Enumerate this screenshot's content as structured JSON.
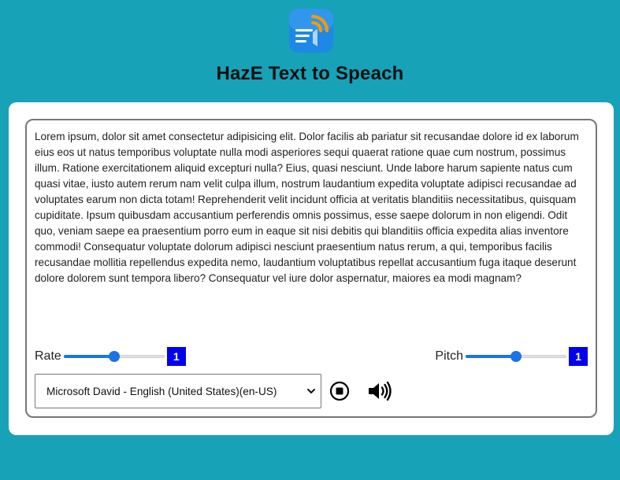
{
  "app": {
    "title": "HazE Text to Speach",
    "logo_icon": "speech-text-logo-icon"
  },
  "editor": {
    "text": "Lorem ipsum, dolor sit amet consectetur adipisicing elit. Dolor facilis ab pariatur sit recusandae dolore id ex laborum eius eos ut natus temporibus voluptate nulla modi asperiores sequi quaerat ratione quae cum nostrum, possimus illum. Ratione exercitationem aliquid excepturi nulla? Eius, quasi nesciunt. Unde labore harum sapiente natus cum quasi vitae, iusto autem rerum nam velit culpa illum, nostrum laudantium expedita voluptate adipisci recusandae ad voluptates earum non dicta totam! Reprehenderit velit incidunt officia at veritatis blanditiis necessitatibus, quisquam cupiditate. Ipsum quibusdam accusantium perferendis omnis possimus, esse saepe dolorum in non eligendi. Odit quo, veniam saepe ea praesentium porro eum in eaque sit nisi debitis qui blanditiis officia expedita alias inventore commodi! Consequatur voluptate dolorum adipisci nesciunt praesentium natus rerum, a qui, temporibus facilis recusandae mollitia repellendus expedita nemo, laudantium voluptatibus repellat accusantium fuga itaque deserunt dolore dolorem sunt tempora libero? Consequatur vel iure dolor aspernatur, maiores ea modi magnam?"
  },
  "controls": {
    "rate": {
      "label": "Rate",
      "value": "1",
      "level": 0.5
    },
    "pitch": {
      "label": "Pitch",
      "value": "1",
      "level": 0.5
    },
    "voice": {
      "selected": "Microsoft David - English (United States)(en-US)"
    },
    "stop_icon": "stop-icon",
    "speak_icon": "speaker-icon"
  },
  "colors": {
    "background": "#17a2b8",
    "accent": "#1a73e8",
    "badge": "#0000ee"
  }
}
